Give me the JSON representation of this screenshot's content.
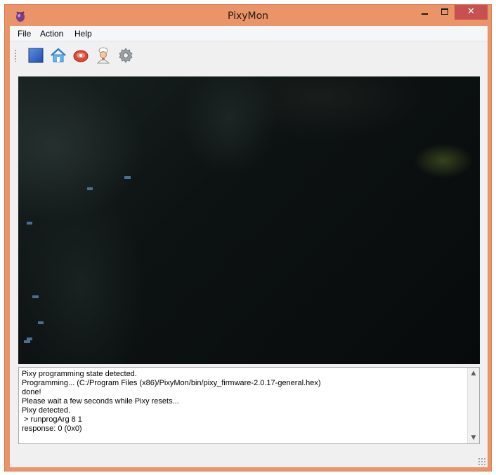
{
  "window": {
    "title": "PixyMon",
    "close_label": "✕"
  },
  "menu": {
    "items": [
      "File",
      "Action",
      "Help"
    ]
  },
  "toolbar": {
    "buttons": [
      {
        "icon": "stop-icon"
      },
      {
        "icon": "home-icon"
      },
      {
        "icon": "raw-video-icon"
      },
      {
        "icon": "cooked-video-icon"
      },
      {
        "icon": "gear-icon"
      }
    ]
  },
  "console": {
    "lines": [
      "Pixy programming state detected.",
      "Programming... (C:/Program Files (x86)/PixyMon/bin/pixy_firmware-2.0.17-general.hex)",
      "done!",
      "Please wait a few seconds while Pixy resets...",
      "Pixy detected.",
      " > runprogArg 8 1",
      "response: 0 (0x0)"
    ]
  },
  "colors": {
    "accent": "#eb9467",
    "close": "#c75050",
    "block": "#4a6f93"
  }
}
